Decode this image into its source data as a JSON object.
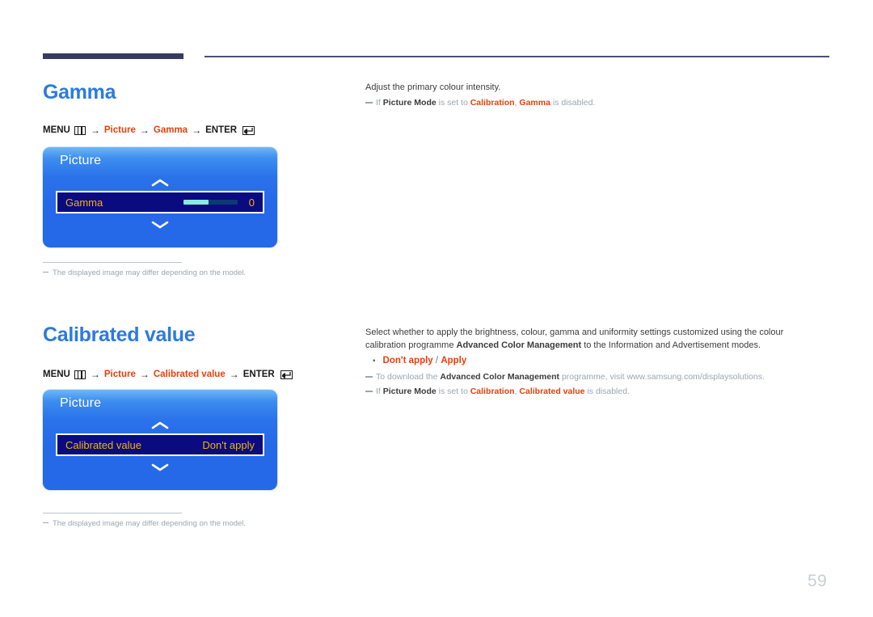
{
  "page": {
    "number": "59"
  },
  "sections": [
    {
      "title": "Gamma",
      "path": {
        "menu_label": "MENU",
        "menu_icon": "menu-grid-icon",
        "arrow": "→",
        "crumb1": "Picture",
        "crumb2": "Gamma",
        "enter_label": "ENTER",
        "enter_icon": "enter-return-icon"
      },
      "osd": {
        "title": "Picture",
        "up_icon": "chevron-up-icon",
        "down_icon": "chevron-down-icon",
        "row_label": "Gamma",
        "row_value": "0",
        "has_slider": true,
        "slider_fill_percent": 46
      },
      "footnote": "The displayed image may differ depending on the model."
    },
    {
      "title": "Calibrated value",
      "path": {
        "menu_label": "MENU",
        "menu_icon": "menu-grid-icon",
        "arrow": "→",
        "crumb1": "Picture",
        "crumb2": "Calibrated value",
        "enter_label": "ENTER",
        "enter_icon": "enter-return-icon"
      },
      "osd": {
        "title": "Picture",
        "up_icon": "chevron-up-icon",
        "down_icon": "chevron-down-icon",
        "row_label": "Calibrated value",
        "row_value": "Don't apply",
        "has_slider": false
      },
      "footnote": "The displayed image may differ depending on the model."
    }
  ],
  "gamma_desc": {
    "intro": "Adjust the primary colour intensity.",
    "note_if": "If ",
    "note_b1": "Picture Mode",
    "note_mid1": " is set to ",
    "note_b2": "Calibration",
    "note_comma": ", ",
    "note_b3": "Gamma",
    "note_end": " is disabled."
  },
  "calibrated_desc": {
    "para_part1": "Select whether to apply the brightness, colour, gamma and uniformity settings customized using the colour calibration programme ",
    "para_bold": "Advanced Color Management",
    "para_part2": " to the Information and Advertisement modes.",
    "option_a": "Don't apply",
    "option_sep": "/",
    "option_b": "Apply",
    "note1_pre": "To download the ",
    "note1_bold": "Advanced Color Management",
    "note1_post": " programme, visit www.samsung.com/displaysolutions.",
    "note2_if": "If ",
    "note2_b1": "Picture Mode",
    "note2_mid": " is set to ",
    "note2_b2": "Calibration",
    "note2_comma": ", ",
    "note2_b3": "Calibrated value",
    "note2_end": " is disabled."
  },
  "colors": {
    "heading_blue": "#2c7ae0",
    "accent_red": "#e8400c",
    "osd_blue": "#2568e8",
    "osd_row_navy": "#0b0b80",
    "osd_row_gold": "#f0b400",
    "rule_navy": "#353c63",
    "muted_gray": "#9aa7b0"
  }
}
